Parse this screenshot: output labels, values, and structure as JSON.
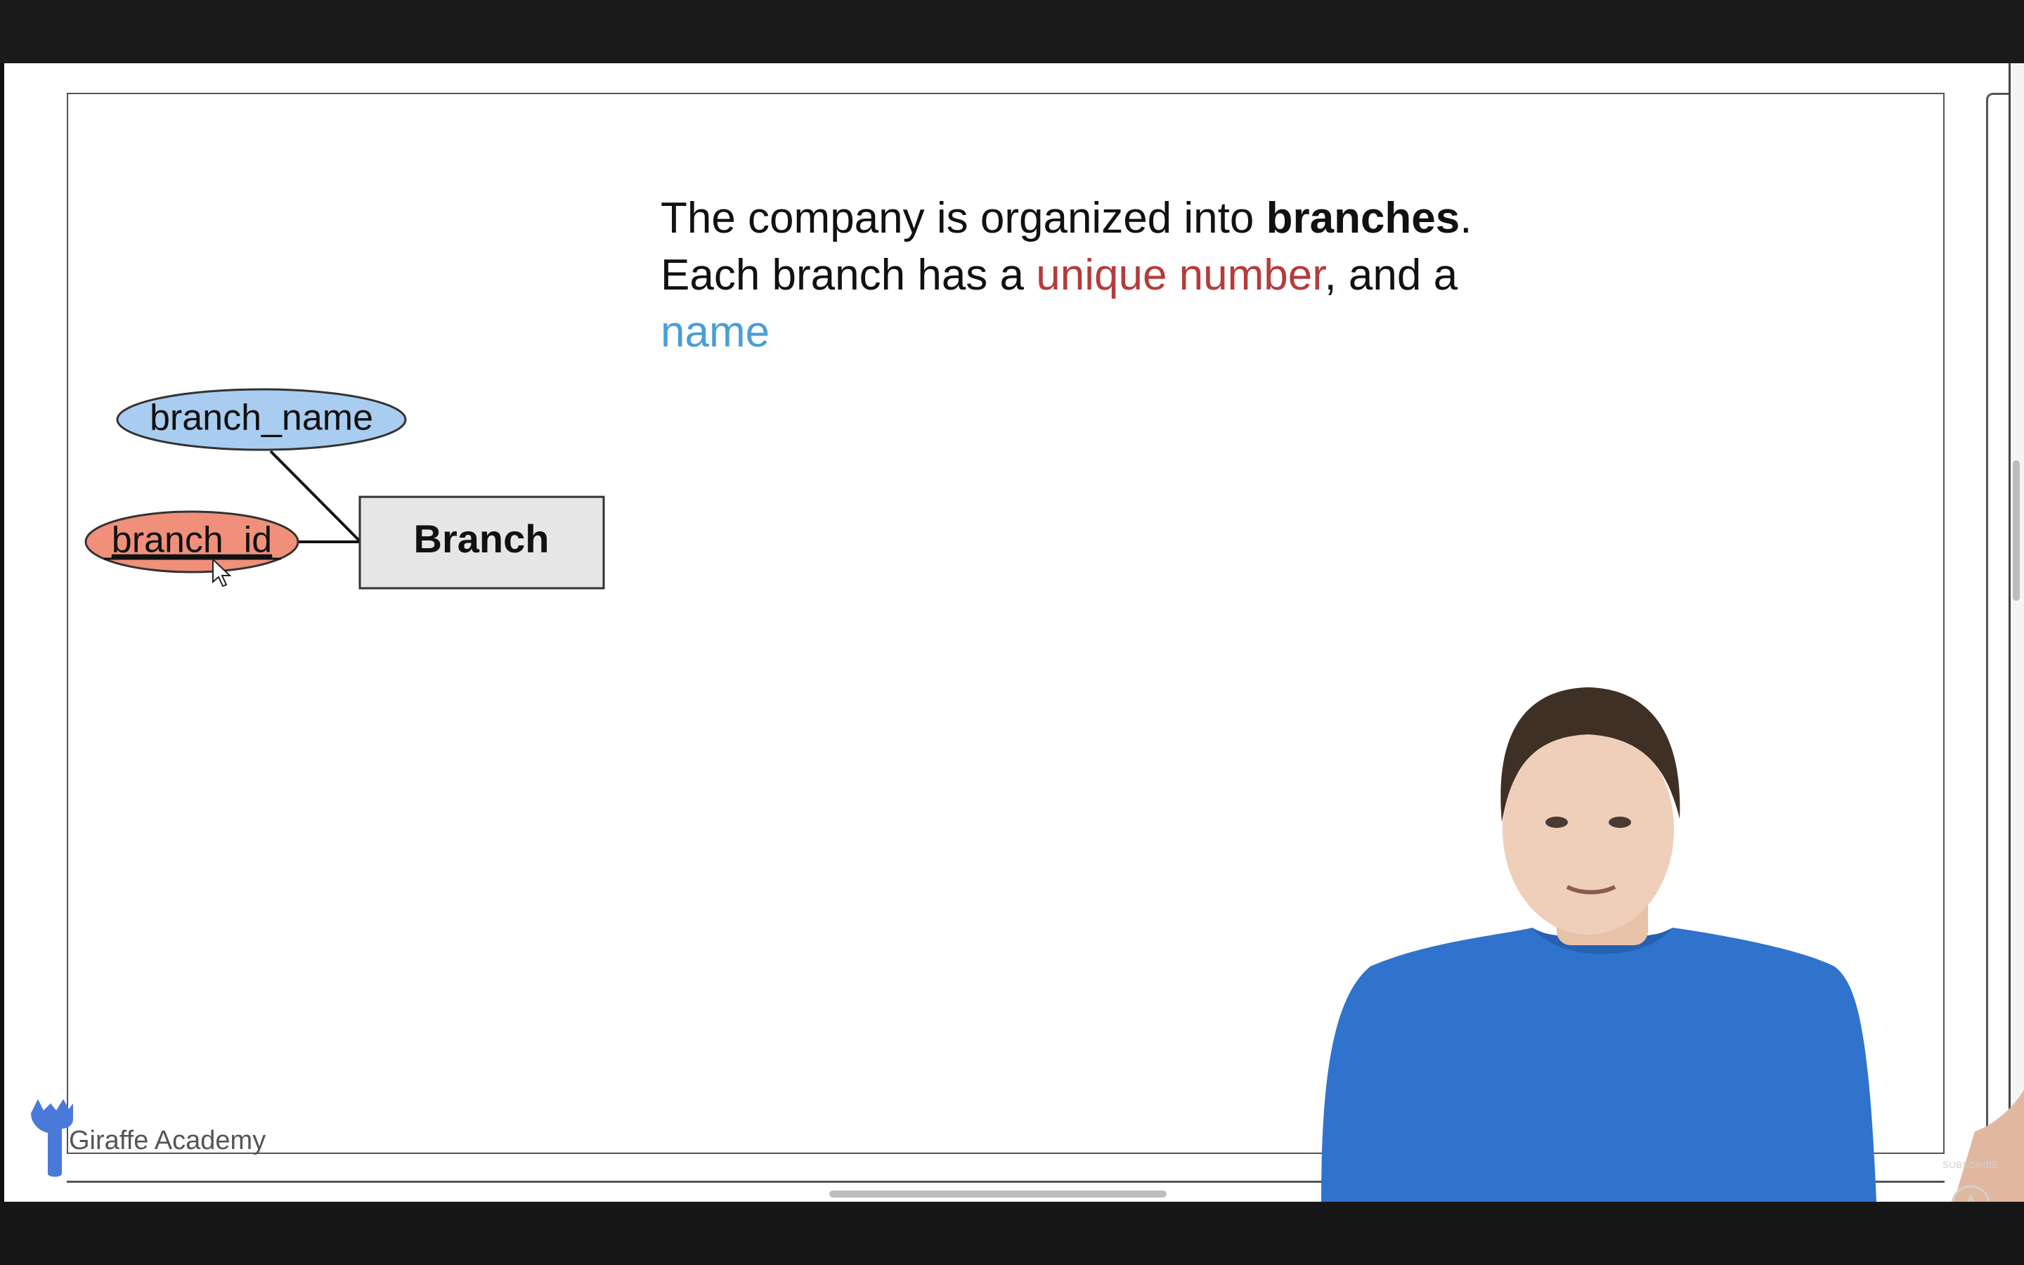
{
  "slide": {
    "line1_pre": "The company is organized into ",
    "line1_bold": "branches",
    "line1_post": ".",
    "line2_pre": "Each branch has a ",
    "line2_red": "unique number",
    "line2_post": ", and a",
    "line3_blue": "name"
  },
  "diagram": {
    "entity": "Branch",
    "attribute_name": "branch_name",
    "attribute_key": "branch_id"
  },
  "brand": {
    "name": "Giraffe Academy"
  },
  "overlay": {
    "subscribe": "SUBSCRIBE"
  },
  "colors": {
    "key_attribute_fill": "#f0907a",
    "attribute_fill": "#a9cdf0",
    "entity_fill": "#e6e6e6",
    "highlight_red": "#b43c3c",
    "highlight_blue": "#4a9fd4",
    "shirt": "#2f73cc"
  }
}
